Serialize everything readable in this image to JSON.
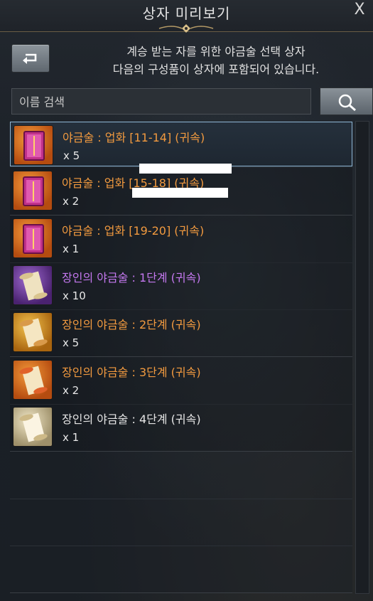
{
  "window": {
    "title": "상자 미리보기",
    "close_label": "X"
  },
  "header": {
    "description_line1": "계승 받는 자를 위한 야금술 선택 상자",
    "description_line2": "다음의 구성품이 상자에 포함되어 있습니다."
  },
  "search": {
    "placeholder": "이름 검색",
    "value": ""
  },
  "items": [
    {
      "name": "야금술 : 업화 [11-14] (귀속)",
      "qty": "x 5",
      "color": "#f29a3f",
      "icon": "metallurgy-book-icon"
    },
    {
      "name": "야금술 : 업화 [15-18] (귀속)",
      "qty": "x 2",
      "color": "#f29a3f",
      "icon": "metallurgy-book-icon"
    },
    {
      "name": "야금술 : 업화 [19-20] (귀속)",
      "qty": "x 1",
      "color": "#f29a3f",
      "icon": "metallurgy-book-icon"
    },
    {
      "name": "장인의 야금술 : 1단계 (귀속)",
      "qty": "x 10",
      "color": "#c478ef",
      "icon": "scroll-icon"
    },
    {
      "name": "장인의 야금술 : 2단계 (귀속)",
      "qty": "x 5",
      "color": "#f29a3f",
      "icon": "scroll-icon"
    },
    {
      "name": "장인의 야금술 : 3단계 (귀속)",
      "qty": "x 2",
      "color": "#f29a3f",
      "icon": "scroll-icon"
    },
    {
      "name": "장인의 야금술 : 4단계 (귀속)",
      "qty": "x 1",
      "color": "#e5e5e5",
      "icon": "scroll-icon"
    }
  ],
  "colors": {
    "accent_border": "#8fb7d6",
    "title_divider": "#6a5d45"
  }
}
